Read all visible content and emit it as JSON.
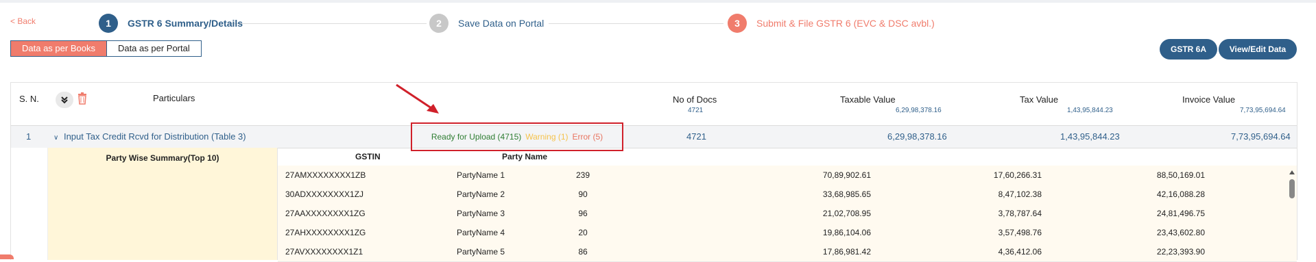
{
  "nav": {
    "back": "< Back"
  },
  "steps": [
    {
      "num": "1",
      "label": "GSTR 6 Summary/Details"
    },
    {
      "num": "2",
      "label": "Save Data on Portal"
    },
    {
      "num": "3",
      "label": "Submit & File GSTR 6 (EVC & DSC avbl.)"
    }
  ],
  "toggle": {
    "books": "Data as per Books",
    "portal": "Data as per Portal"
  },
  "actions": {
    "gstr6a": "GSTR 6A",
    "view_edit": "View/Edit Data"
  },
  "table": {
    "headers": {
      "sn": "S. N.",
      "particulars": "Particulars",
      "docs": "No of Docs",
      "taxable": "Taxable Value",
      "tax": "Tax Value",
      "invoice": "Invoice Value"
    },
    "totals": {
      "docs": "4721",
      "taxable": "6,29,98,378.16",
      "tax": "1,43,95,844.23",
      "invoice": "7,73,95,694.64"
    },
    "row": {
      "sn": "1",
      "label": "Input Tax Credit Rcvd for Distribution (Table 3)",
      "status": {
        "ready": "Ready for Upload (4715)",
        "warning": "Warning (1)",
        "error": "Error (5)"
      },
      "docs": "4721",
      "taxable": "6,29,98,378.16",
      "tax": "1,43,95,844.23",
      "invoice": "7,73,95,694.64"
    },
    "party_summary": "Party Wise Summary(Top 10)",
    "sub_headers": {
      "gstin": "GSTIN",
      "party_name": "Party Name"
    },
    "parties": [
      {
        "gstin": "27AMXXXXXXXX1ZB",
        "name": "PartyName 1",
        "docs": "239",
        "taxable": "70,89,902.61",
        "tax": "17,60,266.31",
        "invoice": "88,50,169.01"
      },
      {
        "gstin": "30ADXXXXXXXX1ZJ",
        "name": "PartyName 2",
        "docs": "90",
        "taxable": "33,68,985.65",
        "tax": "8,47,102.38",
        "invoice": "42,16,088.28"
      },
      {
        "gstin": "27AAXXXXXXXX1ZG",
        "name": "PartyName 3",
        "docs": "96",
        "taxable": "21,02,708.95",
        "tax": "3,78,787.64",
        "invoice": "24,81,496.75"
      },
      {
        "gstin": "27AHXXXXXXXX1ZG",
        "name": "PartyName 4",
        "docs": "20",
        "taxable": "19,86,104.06",
        "tax": "3,57,498.76",
        "invoice": "23,43,602.80"
      },
      {
        "gstin": "27AVXXXXXXXX1Z1",
        "name": "PartyName 5",
        "docs": "86",
        "taxable": "17,86,981.42",
        "tax": "4,36,412.06",
        "invoice": "22,23,393.90"
      }
    ]
  },
  "colors": {
    "primary": "#2f5f8a",
    "accent": "#f07c6c",
    "success": "#2e7d32",
    "warning": "#f5c24b",
    "error": "#e8735f",
    "highlight": "#d0202a",
    "summary_bg": "#fff6d9"
  }
}
